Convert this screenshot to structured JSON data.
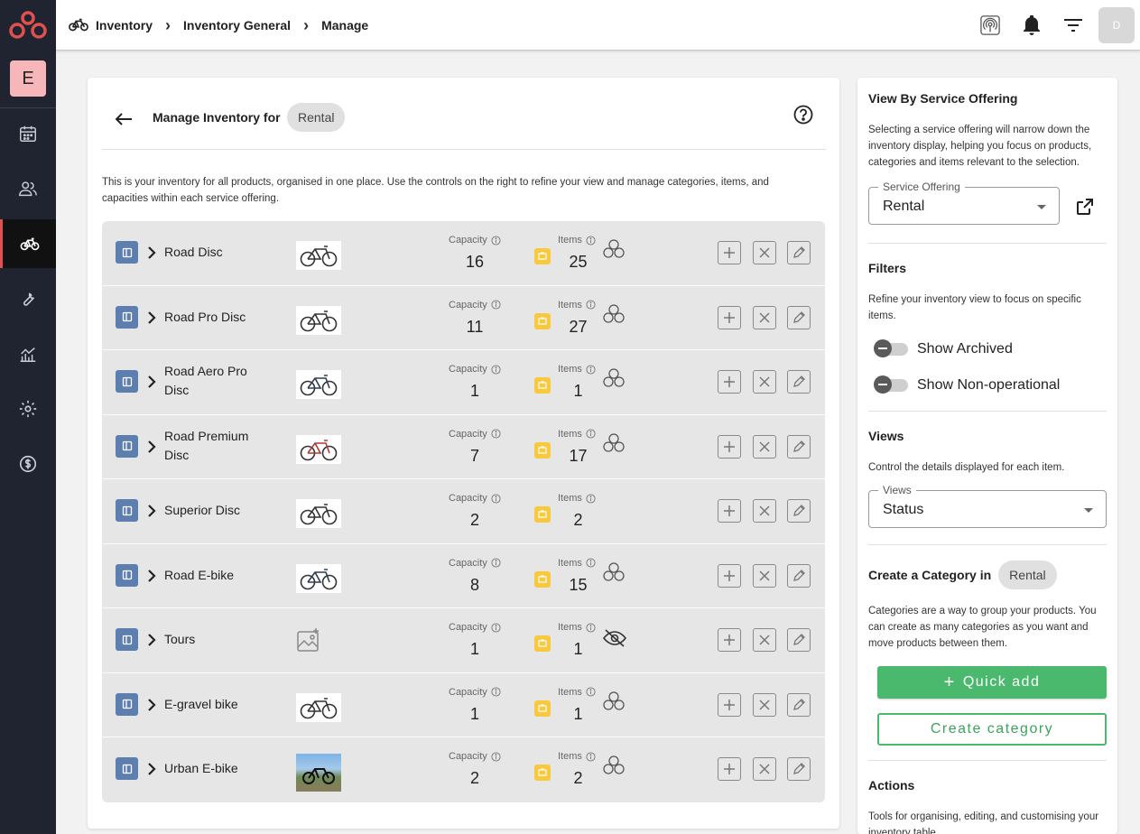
{
  "sidebar": {
    "avatar_letter": "E",
    "items": [
      {
        "icon": "calendar-icon"
      },
      {
        "icon": "users-icon"
      },
      {
        "icon": "bicycle-icon",
        "active": true
      },
      {
        "icon": "wrench-icon"
      },
      {
        "icon": "analytics-icon"
      },
      {
        "icon": "settings-icon"
      },
      {
        "icon": "billing-icon"
      }
    ]
  },
  "topbar": {
    "breadcrumbs": [
      "Inventory",
      "Inventory General",
      "Manage"
    ],
    "user_initial": "D"
  },
  "main": {
    "title": "Manage Inventory for",
    "service_chip": "Rental",
    "intro": "This is your inventory for all products, organised in one place. Use the controls on the right to refine your view and manage categories, items, and capacities within each service offering.",
    "capacity_label": "Capacity",
    "items_label": "Items",
    "rows": [
      {
        "name": "Road Disc",
        "capacity": "16",
        "items": "25",
        "status": "group",
        "thumb": "white"
      },
      {
        "name": "Road Pro Disc",
        "capacity": "11",
        "items": "27",
        "status": "group",
        "thumb": "white"
      },
      {
        "name": "Road Aero Pro Disc",
        "capacity": "1",
        "items": "1",
        "status": "group",
        "thumb": "blue"
      },
      {
        "name": "Road Premium Disc",
        "capacity": "7",
        "items": "17",
        "status": "group",
        "thumb": "red"
      },
      {
        "name": "Superior Disc",
        "capacity": "2",
        "items": "2",
        "status": "none",
        "thumb": "white"
      },
      {
        "name": "Road E-bike",
        "capacity": "8",
        "items": "15",
        "status": "group",
        "thumb": "blue"
      },
      {
        "name": "Tours",
        "capacity": "1",
        "items": "1",
        "status": "hidden",
        "thumb": "placeholder"
      },
      {
        "name": "E-gravel bike",
        "capacity": "1",
        "items": "1",
        "status": "group",
        "thumb": "white"
      },
      {
        "name": "Urban E-bike",
        "capacity": "2",
        "items": "2",
        "status": "group",
        "thumb": "photo"
      }
    ]
  },
  "right": {
    "view_heading": "View By Service Offering",
    "view_desc": "Selecting a service offering will narrow down the inventory display, helping you focus on products, categories and items relevant to the selection.",
    "service_select_label": "Service Offering",
    "service_select_value": "Rental",
    "filters_heading": "Filters",
    "filters_desc": "Refine your inventory view to focus on specific items.",
    "toggle_archived": "Show Archived",
    "toggle_nonop": "Show Non-operational",
    "views_heading": "Views",
    "views_desc": "Control the details displayed for each item.",
    "views_select_label": "Views",
    "views_select_value": "Status",
    "create_heading": "Create a Category in",
    "create_chip": "Rental",
    "create_desc": "Categories are a way to group your products. You can create as many categories as you want and move products between them.",
    "quick_add": "Quick add",
    "create_category": "Create category",
    "actions_heading": "Actions",
    "actions_desc": "Tools for organising, editing, and customising your inventory table."
  },
  "colors": {
    "sidebar_bg": "#1f2430",
    "active_indicator": "#e0504f",
    "category_icon": "#5d7fb0",
    "badge_yellow": "#f9c93d",
    "primary_green": "#4ab96d"
  }
}
